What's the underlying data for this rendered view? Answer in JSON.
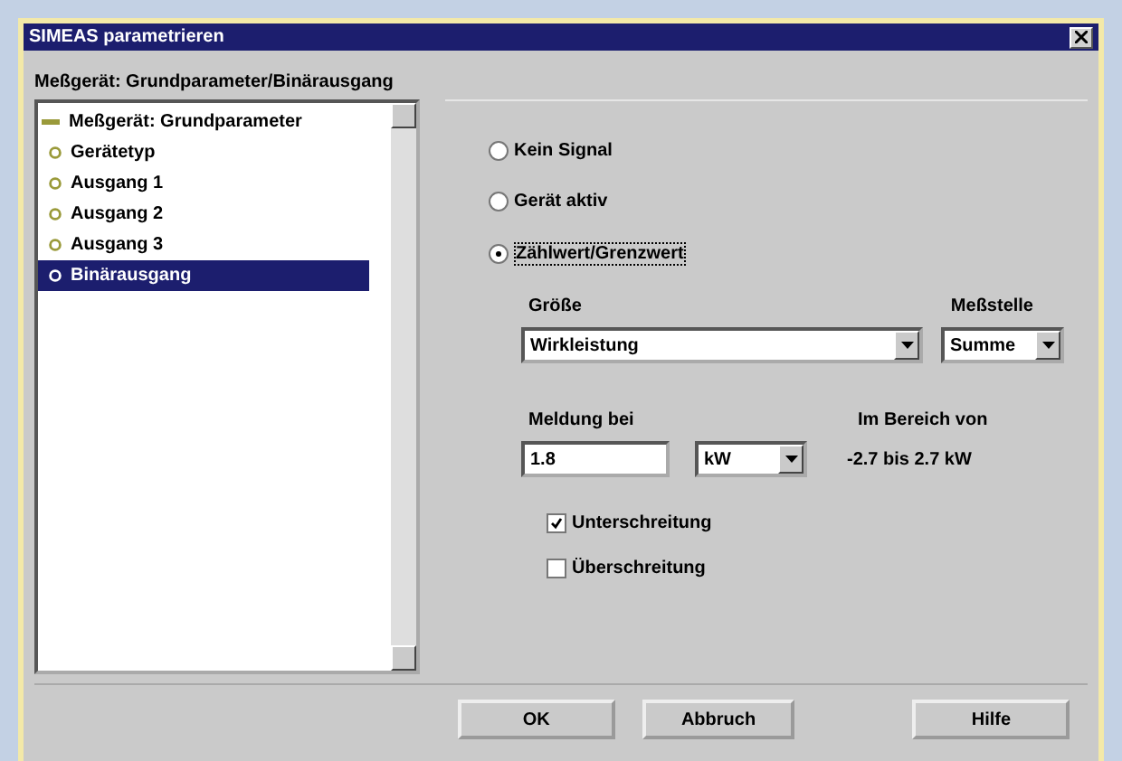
{
  "window": {
    "title": "SIMEAS parametrieren"
  },
  "heading": "Meßgerät: Grundparameter/Binärausgang",
  "tree": {
    "label": "Meßgerät: Grundparameter",
    "expanded": true,
    "children": [
      {
        "label": "Gerätetyp",
        "selected": false
      },
      {
        "label": "Ausgang 1",
        "selected": false
      },
      {
        "label": "Ausgang 2",
        "selected": false
      },
      {
        "label": "Ausgang 3",
        "selected": false
      },
      {
        "label": "Binärausgang",
        "selected": true
      }
    ]
  },
  "signal_options": [
    {
      "label": "Kein Signal",
      "selected": false
    },
    {
      "label": "Gerät aktiv",
      "selected": false
    },
    {
      "label": "Zählwert/Grenzwert",
      "selected": true
    }
  ],
  "size": {
    "label": "Größe",
    "value": "Wirkleistung"
  },
  "measuring_point": {
    "label": "Meßstelle",
    "value": "Summe"
  },
  "message": {
    "label": "Meldung bei",
    "value": "1.8",
    "unit": "kW"
  },
  "range": {
    "label": "Im Bereich von",
    "value": "-2.7 bis 2.7 kW"
  },
  "limits": [
    {
      "label": "Unterschreitung",
      "checked": true
    },
    {
      "label": "Überschreitung",
      "checked": false
    }
  ],
  "buttons": [
    "OK",
    "Abbruch",
    "Hilfe"
  ]
}
